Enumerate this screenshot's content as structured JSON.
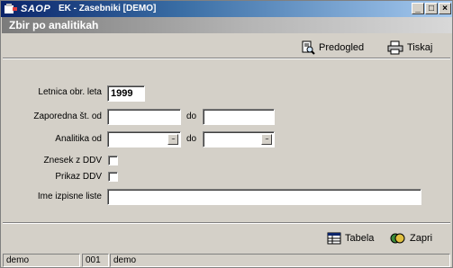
{
  "window": {
    "brand": "SAOP",
    "title": "EK - Zasebniki [DEMO]",
    "controls": {
      "minimize": "_",
      "restore": "□",
      "close": "×"
    }
  },
  "banner": {
    "title": "Zbir po analitikah"
  },
  "toolbar": {
    "preview_label": "Predogled",
    "print_label": "Tiskaj"
  },
  "form": {
    "year_label": "Letnica obr. leta",
    "year_value": "1999",
    "seq_label": "Zaporedna št. od",
    "seq_from": "",
    "seq_to_label": "do",
    "seq_to": "",
    "analytics_label": "Analitika od",
    "analytics_from": "",
    "analytics_to_label": "do",
    "analytics_to": "",
    "browse_glyph": "...",
    "amount_vat_label": "Znesek z DDV",
    "show_vat_label": "Prikaz DDV",
    "list_name_label": "Ime izpisne liste",
    "list_name_value": ""
  },
  "bottom": {
    "table_label": "Tabela",
    "close_label": "Zapri"
  },
  "statusbar": {
    "user": "demo",
    "code": "001",
    "company": "demo"
  },
  "colors": {
    "titlebar_start": "#0a246a",
    "face": "#d4d0c8"
  }
}
